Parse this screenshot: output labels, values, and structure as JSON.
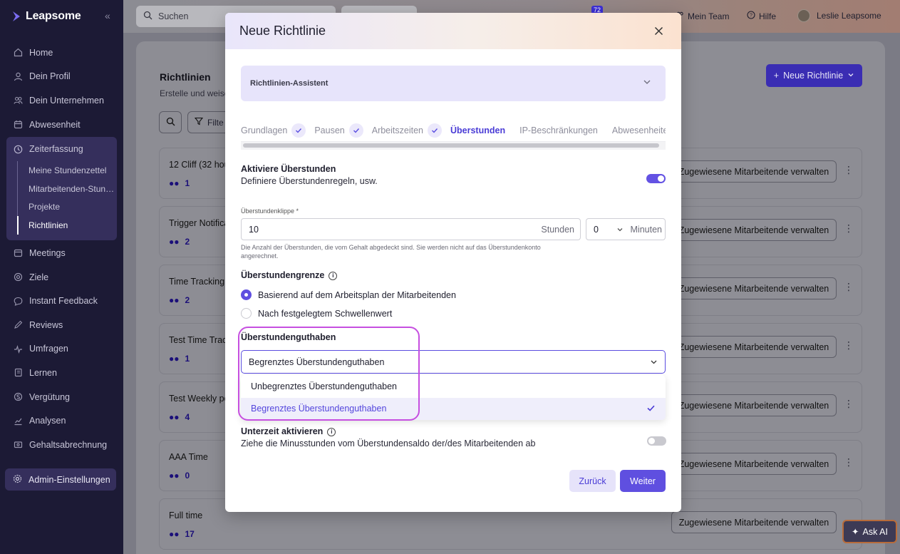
{
  "app": {
    "name": "Leapsome"
  },
  "sidebar": {
    "items": [
      {
        "label": "Home",
        "icon": "home-icon"
      },
      {
        "label": "Dein Profil",
        "icon": "user-icon"
      },
      {
        "label": "Dein Unternehmen",
        "icon": "users-icon"
      },
      {
        "label": "Abwesenheit",
        "icon": "calendar-icon"
      }
    ],
    "group": {
      "label": "Zeiterfassung",
      "icon": "clock-icon",
      "subitems": [
        "Meine Stundenzettel",
        "Mitarbeitenden-Stun…",
        "Projekte",
        "Richtlinien"
      ],
      "active": "Richtlinien"
    },
    "items2": [
      {
        "label": "Meetings",
        "icon": "calendar-icon"
      },
      {
        "label": "Ziele",
        "icon": "target-icon"
      },
      {
        "label": "Instant Feedback",
        "icon": "chat-icon"
      },
      {
        "label": "Reviews",
        "icon": "pen-icon"
      },
      {
        "label": "Umfragen",
        "icon": "pulse-icon"
      },
      {
        "label": "Lernen",
        "icon": "book-icon"
      },
      {
        "label": "Vergütung",
        "icon": "money-icon"
      },
      {
        "label": "Analysen",
        "icon": "chart-icon"
      },
      {
        "label": "Gehaltsabrechnung",
        "icon": "payroll-icon"
      }
    ],
    "admin": "Admin-Einstellungen"
  },
  "topbar": {
    "search_placeholder": "Suchen",
    "notification_count": "72",
    "my_team": "Mein Team",
    "help": "Hilfe",
    "user": "Leslie Leapsome"
  },
  "page": {
    "title": "Richtlinien",
    "subtitle": "Erstelle und weise",
    "filter_label": "Filte",
    "new_policy_button": "Neue Richtlinie",
    "manage_label": "Zugewiesene Mitarbeitende verwalten",
    "policies": [
      {
        "name": "12 Cliff (32 hou",
        "count": "1"
      },
      {
        "name": "Trigger Notifica",
        "count": "2"
      },
      {
        "name": "Time Tracking (",
        "count": "2"
      },
      {
        "name": "Test Time Track",
        "count": "1"
      },
      {
        "name": "Test Weekly po",
        "count": "4"
      },
      {
        "name": "AAA Time",
        "count": "0"
      },
      {
        "name": "Full time",
        "count": "17"
      }
    ],
    "ask_ai": "Ask AI"
  },
  "modal": {
    "title": "Neue Richtlinie",
    "assistant": "Richtlinien-Assistent",
    "steps": [
      {
        "label": "Grundlagen",
        "done": true
      },
      {
        "label": "Pausen",
        "done": true
      },
      {
        "label": "Arbeitszeiten",
        "done": true
      },
      {
        "label": "Überstunden",
        "current": true
      },
      {
        "label": "IP-Beschränkungen"
      },
      {
        "label": "Abwesenheite"
      }
    ],
    "activate_title": "Aktiviere Überstunden",
    "activate_desc": "Definiere Überstundenregeln, usw.",
    "activate_on": true,
    "cliff_label": "Überstundenklippe *",
    "cliff_hours": "10",
    "hours_suffix": "Stunden",
    "cliff_minutes": "0",
    "minutes_suffix": "Minuten",
    "cliff_help": "Die Anzahl der Überstunden, die vom Gehalt abgedeckt sind. Sie werden nicht auf das Überstundenkonto angerechnet.",
    "limit_title": "Überstundengrenze",
    "limit_options": [
      "Basierend auf dem Arbeitsplan der Mitarbeitenden",
      "Nach festgelegtem Schwellenwert"
    ],
    "limit_selected": 0,
    "balance_title": "Überstundenguthaben",
    "balance_value": "Begrenztes Überstundenguthaben",
    "balance_options": [
      "Unbegrenztes Überstundenguthaben",
      "Begrenztes Überstundenguthaben"
    ],
    "balance_selected": 1,
    "undertime_title": "Unterzeit aktivieren",
    "undertime_desc": "Ziehe die Minusstunden vom Überstundensaldo der/des Mitarbeitenden ab",
    "undertime_on": false,
    "back_button": "Zurück",
    "next_button": "Weiter"
  },
  "colors": {
    "accent": "#5f4fe0",
    "sidebar": "#1c1a35",
    "highlight": "#c64fe0"
  }
}
